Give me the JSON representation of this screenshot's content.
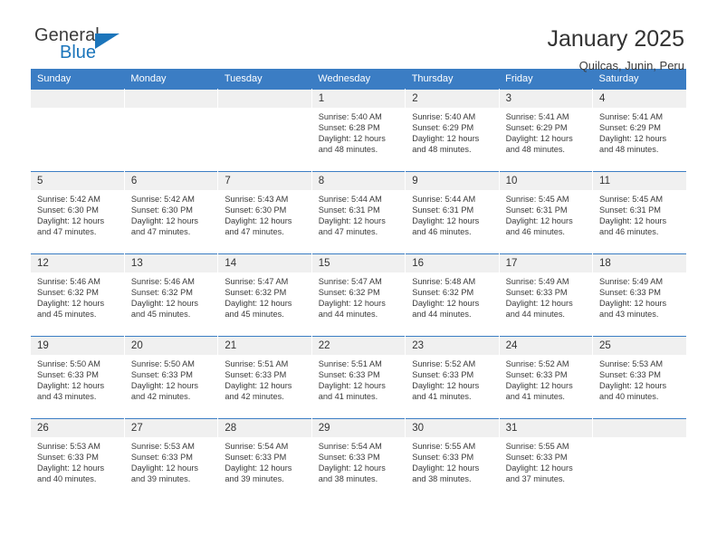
{
  "brand": {
    "name_top": "General",
    "name_bottom": "Blue",
    "triangle_icon": "triangle-icon",
    "accent_color": "#1b75bb"
  },
  "header": {
    "title": "January 2025",
    "subtitle": "Quilcas, Junin, Peru"
  },
  "calendar": {
    "header_bg": "#3b7dc4",
    "daynum_bg": "#f0f0f0",
    "weekdays": [
      "Sunday",
      "Monday",
      "Tuesday",
      "Wednesday",
      "Thursday",
      "Friday",
      "Saturday"
    ],
    "weeks": [
      [
        {
          "day": "",
          "sunrise": "",
          "sunset": "",
          "daylight": "",
          "daylight2": ""
        },
        {
          "day": "",
          "sunrise": "",
          "sunset": "",
          "daylight": "",
          "daylight2": ""
        },
        {
          "day": "",
          "sunrise": "",
          "sunset": "",
          "daylight": "",
          "daylight2": ""
        },
        {
          "day": "1",
          "sunrise": "Sunrise: 5:40 AM",
          "sunset": "Sunset: 6:28 PM",
          "daylight": "Daylight: 12 hours",
          "daylight2": "and 48 minutes."
        },
        {
          "day": "2",
          "sunrise": "Sunrise: 5:40 AM",
          "sunset": "Sunset: 6:29 PM",
          "daylight": "Daylight: 12 hours",
          "daylight2": "and 48 minutes."
        },
        {
          "day": "3",
          "sunrise": "Sunrise: 5:41 AM",
          "sunset": "Sunset: 6:29 PM",
          "daylight": "Daylight: 12 hours",
          "daylight2": "and 48 minutes."
        },
        {
          "day": "4",
          "sunrise": "Sunrise: 5:41 AM",
          "sunset": "Sunset: 6:29 PM",
          "daylight": "Daylight: 12 hours",
          "daylight2": "and 48 minutes."
        }
      ],
      [
        {
          "day": "5",
          "sunrise": "Sunrise: 5:42 AM",
          "sunset": "Sunset: 6:30 PM",
          "daylight": "Daylight: 12 hours",
          "daylight2": "and 47 minutes."
        },
        {
          "day": "6",
          "sunrise": "Sunrise: 5:42 AM",
          "sunset": "Sunset: 6:30 PM",
          "daylight": "Daylight: 12 hours",
          "daylight2": "and 47 minutes."
        },
        {
          "day": "7",
          "sunrise": "Sunrise: 5:43 AM",
          "sunset": "Sunset: 6:30 PM",
          "daylight": "Daylight: 12 hours",
          "daylight2": "and 47 minutes."
        },
        {
          "day": "8",
          "sunrise": "Sunrise: 5:44 AM",
          "sunset": "Sunset: 6:31 PM",
          "daylight": "Daylight: 12 hours",
          "daylight2": "and 47 minutes."
        },
        {
          "day": "9",
          "sunrise": "Sunrise: 5:44 AM",
          "sunset": "Sunset: 6:31 PM",
          "daylight": "Daylight: 12 hours",
          "daylight2": "and 46 minutes."
        },
        {
          "day": "10",
          "sunrise": "Sunrise: 5:45 AM",
          "sunset": "Sunset: 6:31 PM",
          "daylight": "Daylight: 12 hours",
          "daylight2": "and 46 minutes."
        },
        {
          "day": "11",
          "sunrise": "Sunrise: 5:45 AM",
          "sunset": "Sunset: 6:31 PM",
          "daylight": "Daylight: 12 hours",
          "daylight2": "and 46 minutes."
        }
      ],
      [
        {
          "day": "12",
          "sunrise": "Sunrise: 5:46 AM",
          "sunset": "Sunset: 6:32 PM",
          "daylight": "Daylight: 12 hours",
          "daylight2": "and 45 minutes."
        },
        {
          "day": "13",
          "sunrise": "Sunrise: 5:46 AM",
          "sunset": "Sunset: 6:32 PM",
          "daylight": "Daylight: 12 hours",
          "daylight2": "and 45 minutes."
        },
        {
          "day": "14",
          "sunrise": "Sunrise: 5:47 AM",
          "sunset": "Sunset: 6:32 PM",
          "daylight": "Daylight: 12 hours",
          "daylight2": "and 45 minutes."
        },
        {
          "day": "15",
          "sunrise": "Sunrise: 5:47 AM",
          "sunset": "Sunset: 6:32 PM",
          "daylight": "Daylight: 12 hours",
          "daylight2": "and 44 minutes."
        },
        {
          "day": "16",
          "sunrise": "Sunrise: 5:48 AM",
          "sunset": "Sunset: 6:32 PM",
          "daylight": "Daylight: 12 hours",
          "daylight2": "and 44 minutes."
        },
        {
          "day": "17",
          "sunrise": "Sunrise: 5:49 AM",
          "sunset": "Sunset: 6:33 PM",
          "daylight": "Daylight: 12 hours",
          "daylight2": "and 44 minutes."
        },
        {
          "day": "18",
          "sunrise": "Sunrise: 5:49 AM",
          "sunset": "Sunset: 6:33 PM",
          "daylight": "Daylight: 12 hours",
          "daylight2": "and 43 minutes."
        }
      ],
      [
        {
          "day": "19",
          "sunrise": "Sunrise: 5:50 AM",
          "sunset": "Sunset: 6:33 PM",
          "daylight": "Daylight: 12 hours",
          "daylight2": "and 43 minutes."
        },
        {
          "day": "20",
          "sunrise": "Sunrise: 5:50 AM",
          "sunset": "Sunset: 6:33 PM",
          "daylight": "Daylight: 12 hours",
          "daylight2": "and 42 minutes."
        },
        {
          "day": "21",
          "sunrise": "Sunrise: 5:51 AM",
          "sunset": "Sunset: 6:33 PM",
          "daylight": "Daylight: 12 hours",
          "daylight2": "and 42 minutes."
        },
        {
          "day": "22",
          "sunrise": "Sunrise: 5:51 AM",
          "sunset": "Sunset: 6:33 PM",
          "daylight": "Daylight: 12 hours",
          "daylight2": "and 41 minutes."
        },
        {
          "day": "23",
          "sunrise": "Sunrise: 5:52 AM",
          "sunset": "Sunset: 6:33 PM",
          "daylight": "Daylight: 12 hours",
          "daylight2": "and 41 minutes."
        },
        {
          "day": "24",
          "sunrise": "Sunrise: 5:52 AM",
          "sunset": "Sunset: 6:33 PM",
          "daylight": "Daylight: 12 hours",
          "daylight2": "and 41 minutes."
        },
        {
          "day": "25",
          "sunrise": "Sunrise: 5:53 AM",
          "sunset": "Sunset: 6:33 PM",
          "daylight": "Daylight: 12 hours",
          "daylight2": "and 40 minutes."
        }
      ],
      [
        {
          "day": "26",
          "sunrise": "Sunrise: 5:53 AM",
          "sunset": "Sunset: 6:33 PM",
          "daylight": "Daylight: 12 hours",
          "daylight2": "and 40 minutes."
        },
        {
          "day": "27",
          "sunrise": "Sunrise: 5:53 AM",
          "sunset": "Sunset: 6:33 PM",
          "daylight": "Daylight: 12 hours",
          "daylight2": "and 39 minutes."
        },
        {
          "day": "28",
          "sunrise": "Sunrise: 5:54 AM",
          "sunset": "Sunset: 6:33 PM",
          "daylight": "Daylight: 12 hours",
          "daylight2": "and 39 minutes."
        },
        {
          "day": "29",
          "sunrise": "Sunrise: 5:54 AM",
          "sunset": "Sunset: 6:33 PM",
          "daylight": "Daylight: 12 hours",
          "daylight2": "and 38 minutes."
        },
        {
          "day": "30",
          "sunrise": "Sunrise: 5:55 AM",
          "sunset": "Sunset: 6:33 PM",
          "daylight": "Daylight: 12 hours",
          "daylight2": "and 38 minutes."
        },
        {
          "day": "31",
          "sunrise": "Sunrise: 5:55 AM",
          "sunset": "Sunset: 6:33 PM",
          "daylight": "Daylight: 12 hours",
          "daylight2": "and 37 minutes."
        },
        {
          "day": "",
          "sunrise": "",
          "sunset": "",
          "daylight": "",
          "daylight2": ""
        }
      ]
    ]
  }
}
